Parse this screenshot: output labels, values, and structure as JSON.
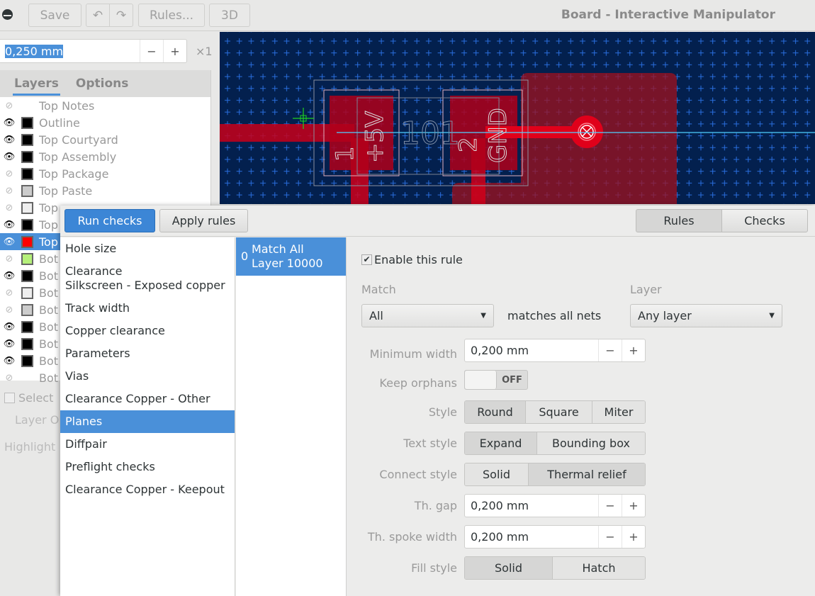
{
  "header": {
    "menu_icon": "menu-icon",
    "save": "Save",
    "undo_icon": "undo-icon",
    "redo_icon": "redo-icon",
    "rules": "Rules...",
    "view3d": "3D",
    "title": "Board - Interactive Manipulator"
  },
  "grid": {
    "value": "0,250 mm",
    "minus": "−",
    "plus": "+",
    "multiplier": "×1"
  },
  "left_panel": {
    "tabs": [
      "Layers",
      "Options"
    ],
    "layers": [
      {
        "name": "Top Notes",
        "visible": false,
        "color": ""
      },
      {
        "name": "Outline",
        "visible": true,
        "color": "#000000"
      },
      {
        "name": "Top Courtyard",
        "visible": true,
        "color": "#000000"
      },
      {
        "name": "Top Assembly",
        "visible": true,
        "color": "#000000"
      },
      {
        "name": "Top Package",
        "visible": false,
        "color": "#000000"
      },
      {
        "name": "Top Paste",
        "visible": false,
        "color": "#cccccc"
      },
      {
        "name": "Top",
        "visible": false,
        "color": "#eeeeee"
      },
      {
        "name": "Top",
        "visible": true,
        "color": "#000000"
      },
      {
        "name": "Top",
        "visible": true,
        "color": "#ff0000",
        "selected": true
      },
      {
        "name": "Bot",
        "visible": false,
        "color": "#b5f07a"
      },
      {
        "name": "Bot",
        "visible": true,
        "color": "#000000"
      },
      {
        "name": "Bot",
        "visible": false,
        "color": "#eeeeee"
      },
      {
        "name": "Bot",
        "visible": false,
        "color": "#cccccc"
      },
      {
        "name": "Bot",
        "visible": true,
        "color": "#000000"
      },
      {
        "name": "Bot",
        "visible": true,
        "color": "#000000"
      },
      {
        "name": "Bot",
        "visible": true,
        "color": "#000000"
      },
      {
        "name": "Bot",
        "visible": false,
        "color": ""
      }
    ],
    "select_label": "Select",
    "layer_label": "Layer O",
    "highlight_label": "Highlight"
  },
  "canvas": {
    "pad1_number": "1",
    "pad1_net": "+5V",
    "ref": "101",
    "pad2_number": "2",
    "pad2_net": "GND",
    "colors": {
      "background": "#03204e",
      "copper": "#e0001a",
      "grid": "#2a6fe0",
      "cursor": "#1fd11f",
      "airwire": "#4fd0ff"
    }
  },
  "dialog": {
    "run_checks": "Run checks",
    "apply_rules": "Apply rules",
    "tab_rules": "Rules",
    "tab_checks": "Checks",
    "rule_types": [
      "Hole size",
      "Clearance Silkscreen - Exposed copper",
      "Track width",
      "Copper clearance",
      "Parameters",
      "Vias",
      "Clearance Copper - Other",
      "Planes",
      "Diffpair",
      "Preflight checks",
      "Clearance Copper - Keepout"
    ],
    "selected_rule_type": "Planes",
    "rule_item": {
      "index": "0",
      "line1": "Match All",
      "line2": "Layer 10000"
    },
    "form": {
      "enable": "Enable this rule",
      "enabled": true,
      "match_label": "Match",
      "match_value": "All",
      "matches_text": "matches all nets",
      "layer_label": "Layer",
      "layer_value": "Any layer",
      "min_width_label": "Minimum width",
      "min_width": "0,200 mm",
      "keep_orphans_label": "Keep orphans",
      "keep_orphans": "OFF",
      "style_label": "Style",
      "style_options": [
        "Round",
        "Square",
        "Miter"
      ],
      "style_selected": "Round",
      "text_style_label": "Text style",
      "text_style_options": [
        "Expand",
        "Bounding box"
      ],
      "text_style_selected": "Expand",
      "connect_style_label": "Connect style",
      "connect_style_options": [
        "Solid",
        "Thermal relief"
      ],
      "connect_style_selected": "Thermal relief",
      "th_gap_label": "Th. gap",
      "th_gap": "0,200 mm",
      "th_spoke_label": "Th. spoke width",
      "th_spoke": "0,200 mm",
      "fill_style_label": "Fill style",
      "fill_style_options": [
        "Solid",
        "Hatch"
      ],
      "fill_style_selected": "Solid",
      "minus": "−",
      "plus": "+"
    }
  }
}
